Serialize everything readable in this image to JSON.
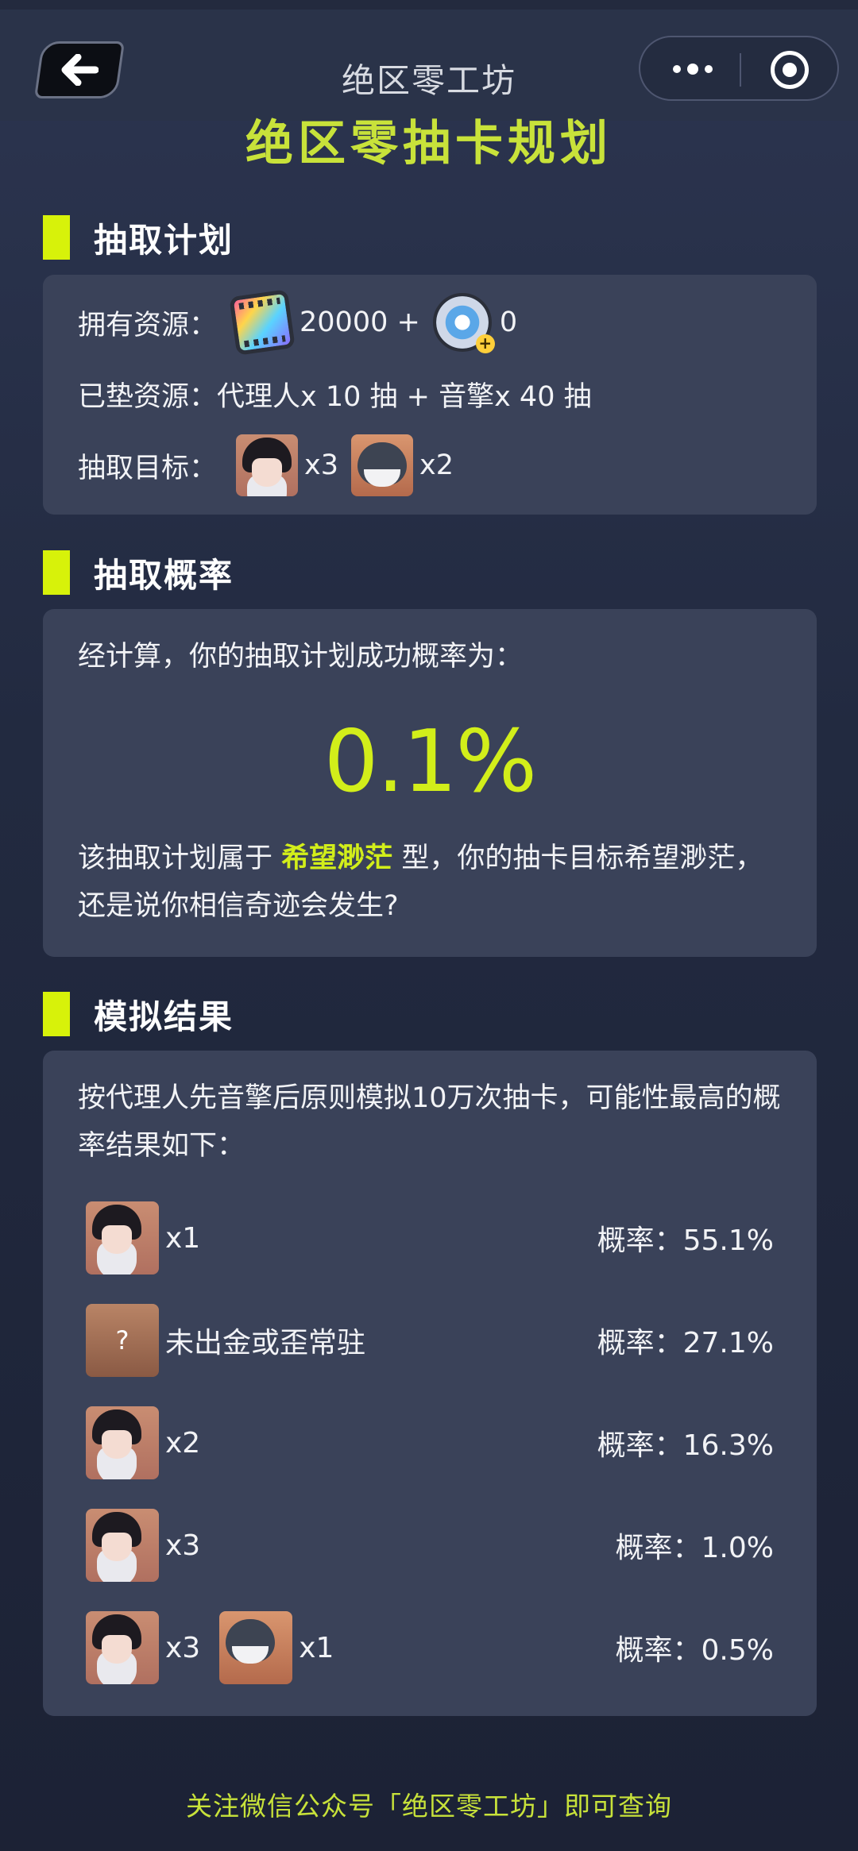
{
  "nav": {
    "title": "绝区零工坊"
  },
  "page": {
    "heading": "绝区零抽卡规划"
  },
  "plan": {
    "section_title": "抽取计划",
    "resources_label": "拥有资源：",
    "film_amount": "20000 +",
    "reel_amount": "0",
    "pity_label": "已垫资源：",
    "pity_value": "代理人x 10 抽 + 音擎x 40 抽",
    "target_label": "抽取目标：",
    "target_agent_count": "x3",
    "target_engine_count": "x2"
  },
  "probability": {
    "section_title": "抽取概率",
    "intro": "经计算，你的抽取计划成功概率为：",
    "value": "0.1%",
    "verdict_prefix": "该抽取计划属于",
    "verdict_type": "希望渺茫",
    "verdict_suffix": "型，你的抽卡目标希望渺茫，还是说你相信奇迹会发生?"
  },
  "simulation": {
    "section_title": "模拟结果",
    "intro": "按代理人先音擎后原则模拟10万次抽卡，可能性最高的概率结果如下：",
    "results": [
      {
        "agent_count": "x1",
        "probability": "概率：55.1%"
      },
      {
        "unknown_glyph": "?",
        "label": "未出金或歪常驻",
        "probability": "概率：27.1%"
      },
      {
        "agent_count": "x2",
        "probability": "概率：16.3%"
      },
      {
        "agent_count": "x3",
        "probability": "概率：1.0%"
      },
      {
        "agent_count": "x3",
        "engine_count": "x1",
        "probability": "概率：0.5%"
      }
    ]
  },
  "footer": {
    "text": "关注微信公众号「绝区零工坊」即可查询"
  },
  "colors": {
    "accent": "#d2ee1a",
    "background": "#222a40",
    "card": "#3a4259"
  },
  "icons": {
    "back": "arrow-left-icon",
    "more": "more-dots-icon",
    "close": "target-circle-icon",
    "film": "master-tape-icon",
    "reel": "encrypted-reel-icon"
  }
}
